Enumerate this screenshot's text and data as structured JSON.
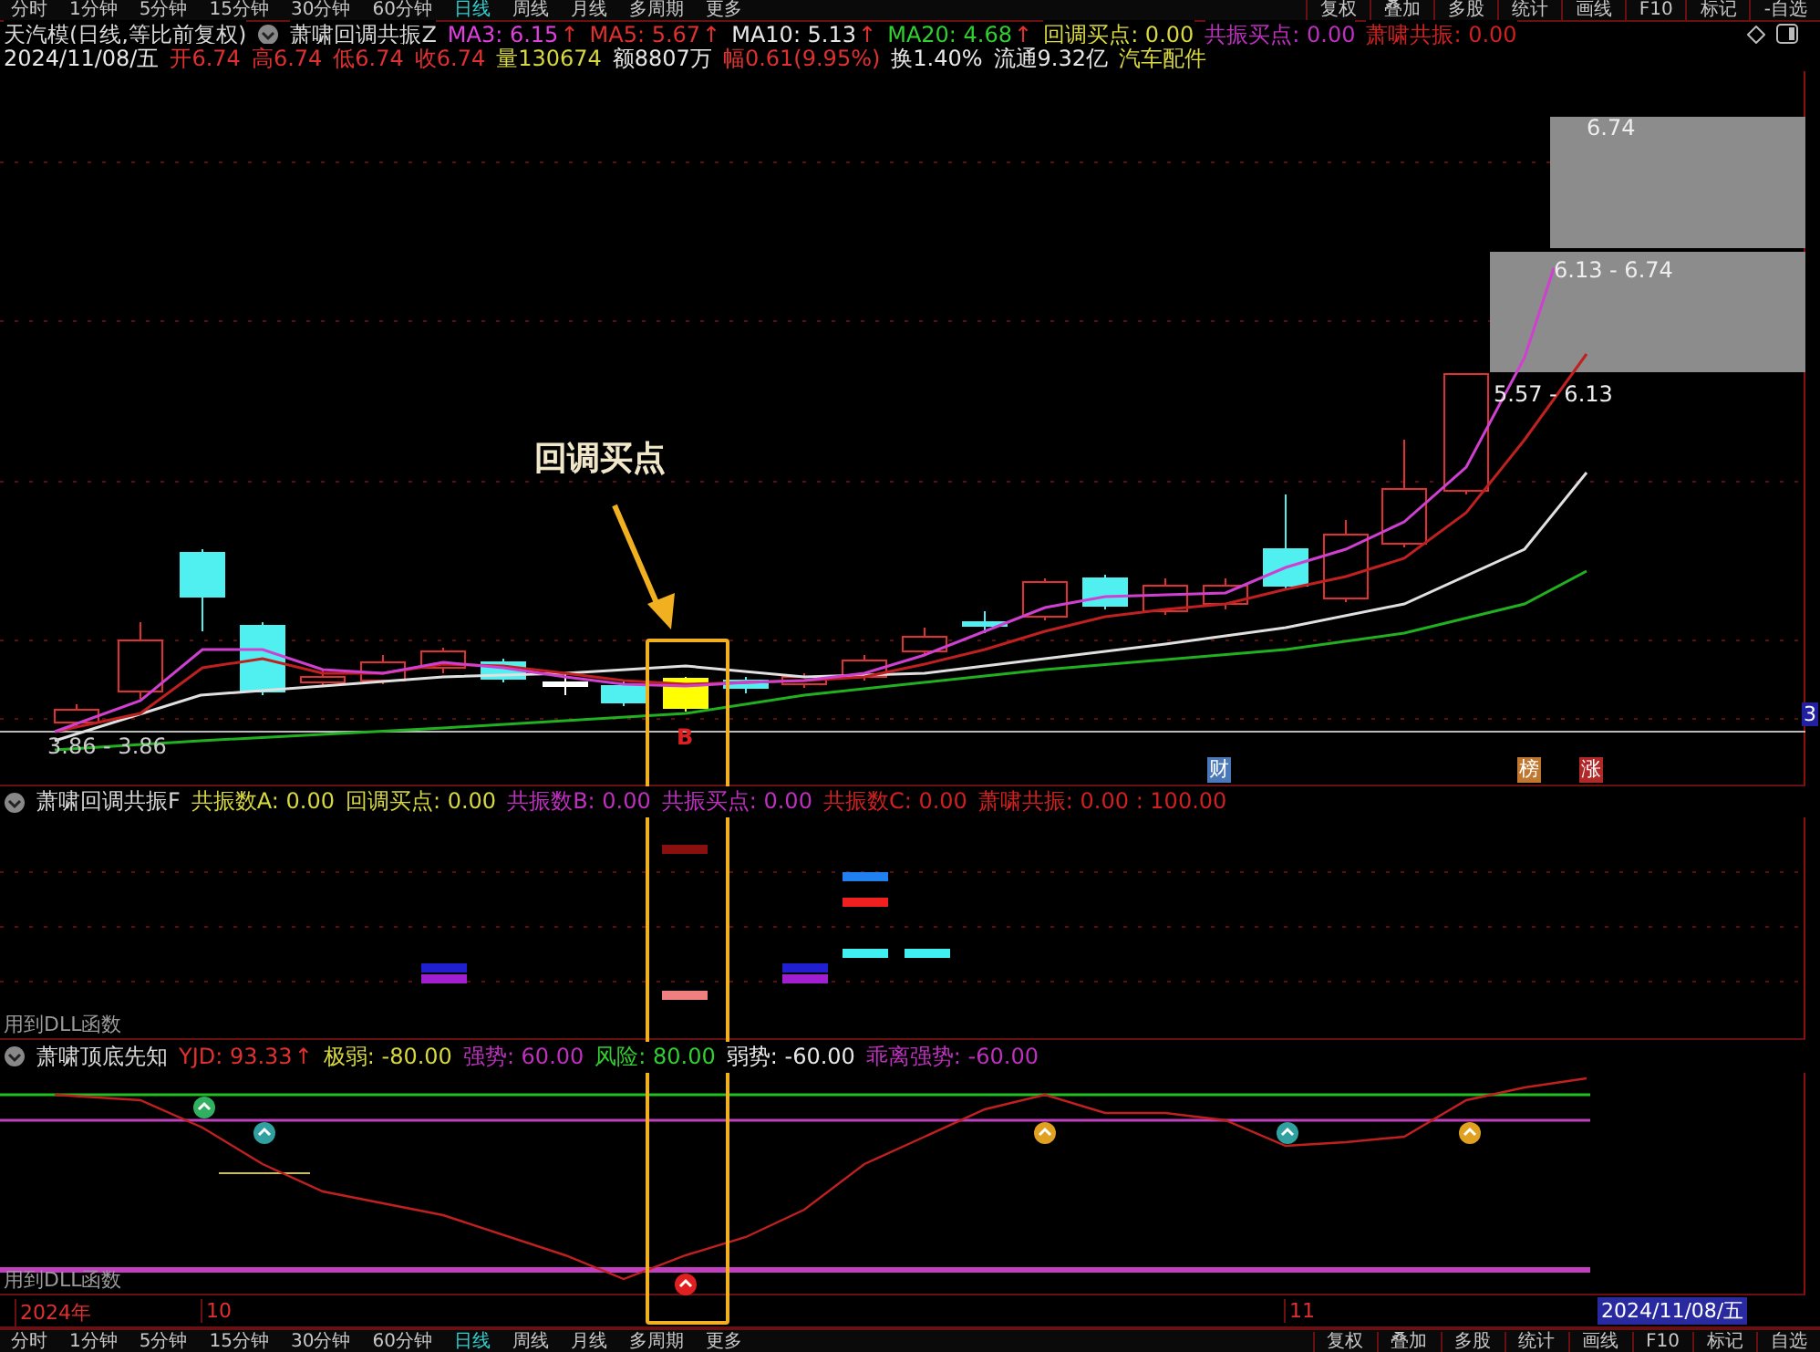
{
  "toolbar_top": {
    "periods": [
      {
        "label": "分时",
        "selected": false
      },
      {
        "label": "1分钟",
        "selected": false
      },
      {
        "label": "5分钟",
        "selected": false
      },
      {
        "label": "15分钟",
        "selected": false
      },
      {
        "label": "30分钟",
        "selected": false
      },
      {
        "label": "60分钟",
        "selected": false
      },
      {
        "label": "日线",
        "selected": true
      },
      {
        "label": "周线",
        "selected": false
      },
      {
        "label": "月线",
        "selected": false
      },
      {
        "label": "多周期",
        "selected": false
      },
      {
        "label": "更多",
        "selected": false
      }
    ],
    "actions": [
      "复权",
      "叠加",
      "多股",
      "统计",
      "画线",
      "F10",
      "标记",
      "-自选"
    ]
  },
  "main_header": {
    "title": "天汽模(日线,等比前复权)",
    "indicator": "萧啸回调共振Z",
    "values": [
      {
        "text": "MA3: 6.15",
        "color": "#e040e0",
        "arrow": "↑"
      },
      {
        "text": "MA5: 5.67",
        "color": "#e03030",
        "arrow": "↑"
      },
      {
        "text": "MA10: 5.13",
        "color": "#e8e8e8",
        "arrow": "↑"
      },
      {
        "text": "MA20: 4.68",
        "color": "#30d030",
        "arrow": "↑"
      },
      {
        "text": "回调买点: 0.00",
        "color": "#d8d840"
      },
      {
        "text": "共振买点: 0.00",
        "color": "#c030c0"
      },
      {
        "text": "萧啸共振: 0.00",
        "color": "#d02020"
      }
    ]
  },
  "quote_line": [
    {
      "text": "2024/11/08/五",
      "color": "#e8e8e8"
    },
    {
      "text": "开6.74",
      "color": "#e03030"
    },
    {
      "text": "高6.74",
      "color": "#e03030"
    },
    {
      "text": "低6.74",
      "color": "#e03030"
    },
    {
      "text": "收6.74",
      "color": "#e03030"
    },
    {
      "text": "量130674",
      "color": "#d8d840"
    },
    {
      "text": "额8807万",
      "color": "#e8e8e8"
    },
    {
      "text": "幅0.61(9.95%)",
      "color": "#e03030"
    },
    {
      "text": "换1.40%",
      "color": "#e8e8e8"
    },
    {
      "text": "流通9.32亿",
      "color": "#e8e8e8"
    },
    {
      "text": "汽车配件",
      "color": "#d8d840"
    }
  ],
  "main_chart": {
    "annotation": "回调买点",
    "buy_mark": "B",
    "price_labels": [
      "6.74",
      "6.13 - 6.74",
      "5.57 - 6.13",
      "3.86 - 3.86"
    ],
    "edge_badge": "3",
    "event_tags": [
      {
        "text": "财",
        "color": "#4a78b8"
      },
      {
        "text": "榜",
        "color": "#c07830"
      },
      {
        "text": "涨",
        "color": "#b02828"
      }
    ]
  },
  "panel_2": {
    "title": "萧啸回调共振F",
    "values": [
      {
        "text": "共振数A: 0.00",
        "color": "#d8d840"
      },
      {
        "text": "回调买点: 0.00",
        "color": "#d8d840"
      },
      {
        "text": "共振数B: 0.00",
        "color": "#c030c0"
      },
      {
        "text": "共振买点: 0.00",
        "color": "#c030c0"
      },
      {
        "text": "共振数C: 0.00",
        "color": "#d02020"
      },
      {
        "text": "萧啸共振: 0.00 : 100.00",
        "color": "#d02020"
      }
    ],
    "footer": "用到DLL函数"
  },
  "panel_3": {
    "title": "萧啸顶底先知",
    "values": [
      {
        "text": "YJD: 93.33",
        "color": "#e03030",
        "arrow": "↑"
      },
      {
        "text": "极弱: -80.00",
        "color": "#d8d840"
      },
      {
        "text": "强势: 60.00",
        "color": "#c030c0"
      },
      {
        "text": "风险: 80.00",
        "color": "#30d030"
      },
      {
        "text": "弱势: -60.00",
        "color": "#e8e8e8"
      },
      {
        "text": "乖离强势: -60.00",
        "color": "#c030c0"
      }
    ],
    "footer": "用到DLL函数"
  },
  "time_axis": {
    "year": "2024年",
    "months": [
      "10",
      "11"
    ],
    "cursor_date": "2024/11/08/五"
  },
  "toolbar_bottom": {
    "periods": [
      {
        "label": "分时",
        "selected": false
      },
      {
        "label": "1分钟",
        "selected": false
      },
      {
        "label": "5分钟",
        "selected": false
      },
      {
        "label": "15分钟",
        "selected": false
      },
      {
        "label": "30分钟",
        "selected": false
      },
      {
        "label": "60分钟",
        "selected": false
      },
      {
        "label": "日线",
        "selected": true
      },
      {
        "label": "周线",
        "selected": false
      },
      {
        "label": "月线",
        "selected": false
      },
      {
        "label": "多周期",
        "selected": false
      },
      {
        "label": "更多",
        "selected": false
      }
    ],
    "actions": [
      "复权",
      "叠加",
      "多股",
      "统计",
      "画线",
      "F10",
      "标记",
      "自选"
    ]
  }
}
